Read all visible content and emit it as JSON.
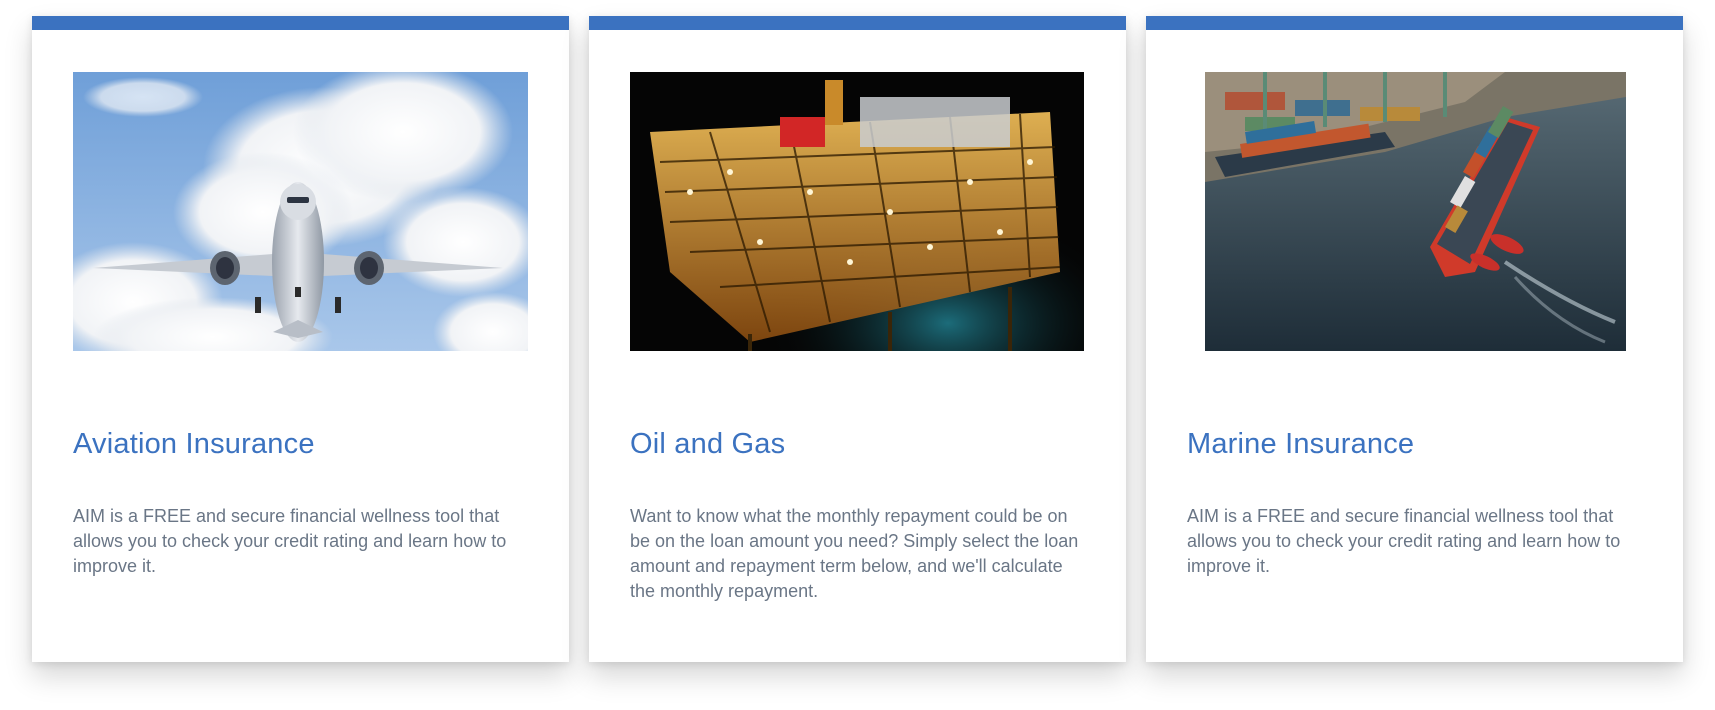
{
  "cards": [
    {
      "title": "Aviation Insurance",
      "description": "AIM is a FREE and secure financial wellness tool that allows you to check your credit rating and learn how to improve it.",
      "image": "airplane-in-clouds-photo"
    },
    {
      "title": "Oil and Gas",
      "description": "Want to know what the monthly repayment could be on be on the loan amount you need? Simply select the loan amount and repayment term below, and we'll calculate the monthly repayment.",
      "image": "offshore-oil-rig-night-photo"
    },
    {
      "title": "Marine Insurance",
      "description": "AIM is a FREE and secure financial wellness tool that allows you to check your credit rating and learn how to improve it.",
      "image": "container-ship-port-photo"
    }
  ],
  "colors": {
    "accent": "#3b72c0",
    "body_text": "#6a7686",
    "card_bg": "#ffffff"
  }
}
